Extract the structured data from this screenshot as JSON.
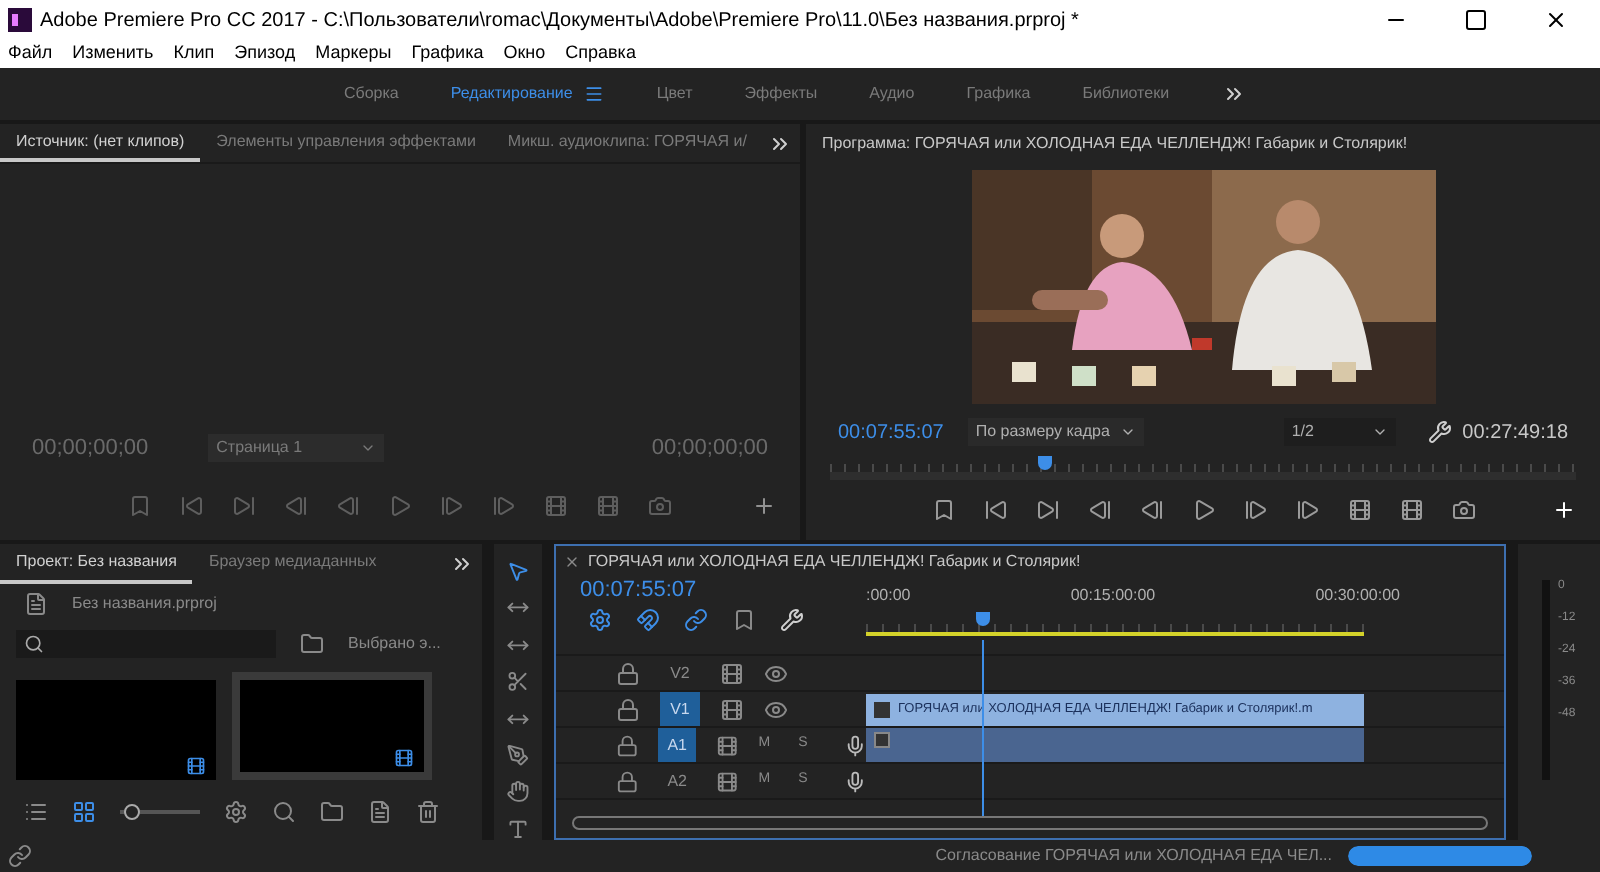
{
  "window": {
    "title": "Adobe Premiere Pro CC 2017 - C:\\Пользователи\\romac\\Документы\\Adobe\\Premiere Pro\\11.0\\Без названия.prproj *"
  },
  "menu": [
    "Файл",
    "Изменить",
    "Клип",
    "Эпизод",
    "Маркеры",
    "Графика",
    "Окно",
    "Справка"
  ],
  "workspaces": [
    {
      "label": "Сборка",
      "selected": false
    },
    {
      "label": "Редактирование",
      "selected": true
    },
    {
      "label": "Цвет",
      "selected": false
    },
    {
      "label": "Эффекты",
      "selected": false
    },
    {
      "label": "Аудио",
      "selected": false
    },
    {
      "label": "Графика",
      "selected": false
    },
    {
      "label": "Библиотеки",
      "selected": false
    }
  ],
  "source_panel": {
    "tabs": [
      {
        "label": "Источник: (нет клипов)",
        "selected": true
      },
      {
        "label": "Элементы управления эффектами",
        "selected": false
      },
      {
        "label": "Микш. аудиоклипа: ГОРЯЧАЯ и/",
        "selected": false
      }
    ],
    "timecode_in": "00;00;00;00",
    "page": "Страница 1",
    "timecode_out": "00;00;00;00"
  },
  "program_panel": {
    "title": "Программа: ГОРЯЧАЯ или ХОЛОДНАЯ ЕДА ЧЕЛЛЕНДЖ! Габарик и Столярик!",
    "timecode": "00:07:55:07",
    "fit": "По размеру кадра",
    "resolution": "1/2",
    "duration": "00:27:49:18",
    "playhead": {
      "level": 0.28
    }
  },
  "project_panel": {
    "tabs": [
      {
        "label": "Проект: Без названия",
        "selected": true
      },
      {
        "label": "Браузер медиаданных",
        "selected": false
      }
    ],
    "file": "Без названия.prproj",
    "selection": "Выбрано э...",
    "zoom": {
      "level": 0.05
    }
  },
  "timeline": {
    "title": "ГОРЯЧАЯ или ХОЛОДНАЯ ЕДА ЧЕЛЛЕНДЖ! Габарик и Столярик!",
    "timecode": "00:07:55:07",
    "ruler": [
      ":00:00",
      "00:15:00:00",
      "00:30:00:00"
    ],
    "playhead": {
      "level": 0.22
    },
    "tracks": [
      {
        "name": "V2",
        "kind": "video",
        "targeted": false
      },
      {
        "name": "V1",
        "kind": "video",
        "targeted": true
      },
      {
        "name": "A1",
        "kind": "audio",
        "targeted": true,
        "mute": "M",
        "solo": "S"
      },
      {
        "name": "A2",
        "kind": "audio",
        "targeted": false,
        "mute": "M",
        "solo": "S"
      }
    ],
    "clip": "ГОРЯЧАЯ или ХОЛОДНАЯ ЕДА ЧЕЛЛЕНДЖ! Габарик и Столярик!.m"
  },
  "meter": [
    "0",
    "-12",
    "-24",
    "-36",
    "-48"
  ],
  "status": {
    "text": "Согласование ГОРЯЧАЯ или ХОЛОДНАЯ ЕДА ЧЕЛ...",
    "progress": {
      "level": 1
    }
  }
}
